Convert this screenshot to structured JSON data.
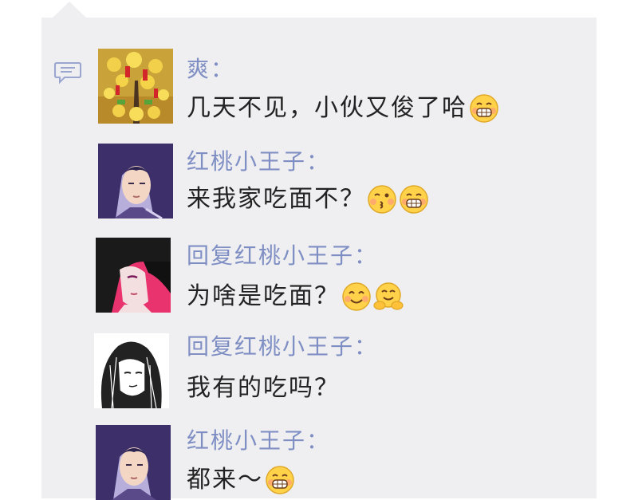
{
  "comments": [
    {
      "author": "爽：",
      "text": "几天不见，小伙又俊了哈",
      "emojis": [
        "grin-emoji"
      ],
      "avatar": "gold-coin-tree-avatar"
    },
    {
      "author": "红桃小王子：",
      "text": "来我家吃面不？",
      "emojis": [
        "kissing-emoji",
        "grin-emoji"
      ],
      "avatar": "purple-hair-prince-avatar"
    },
    {
      "author": "回复红桃小王子：",
      "text": "为啥是吃面？",
      "emojis": [
        "smile-emoji",
        "hug-emoji"
      ],
      "avatar": "dark-hair-anime-avatar"
    },
    {
      "author": "回复红桃小王子：",
      "text": "我有的吃吗？",
      "emojis": [],
      "avatar": "sketch-long-hair-avatar"
    },
    {
      "author": "红桃小王子：",
      "text": "都来～",
      "emojis": [
        "grin-emoji"
      ],
      "avatar": "purple-hair-prince-avatar"
    }
  ],
  "colors": {
    "panel_bg": "#efeff1",
    "author_name": "#7f8fc4",
    "message_text": "#222222",
    "comment_icon": "#9aa6cf"
  }
}
